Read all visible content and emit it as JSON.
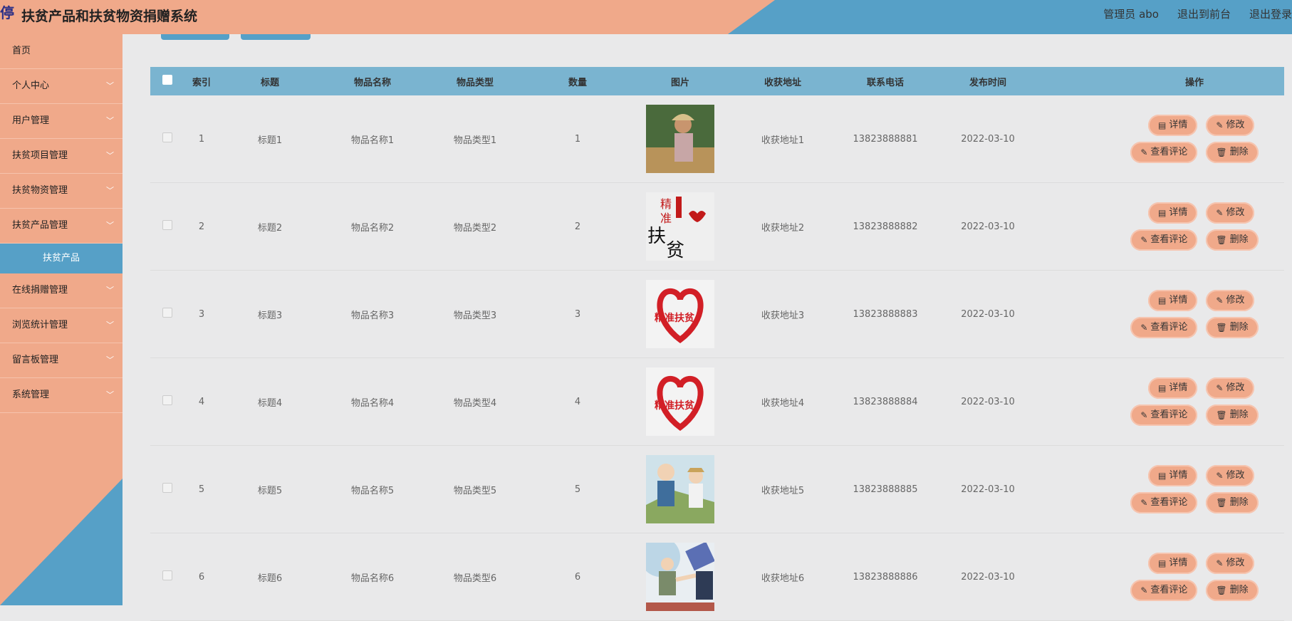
{
  "app": {
    "logo_glyph": "停",
    "title": "扶贫产品和扶贫物资捐赠系统"
  },
  "topbar": {
    "user": "管理员 abo",
    "to_front": "退出到前台",
    "logout": "退出登录"
  },
  "sidebar": {
    "items": [
      {
        "label": "首页",
        "has_chevron": false
      },
      {
        "label": "个人中心",
        "has_chevron": true
      },
      {
        "label": "用户管理",
        "has_chevron": true
      },
      {
        "label": "扶贫项目管理",
        "has_chevron": true
      },
      {
        "label": "扶贫物资管理",
        "has_chevron": true
      },
      {
        "label": "扶贫产品管理",
        "has_chevron": true
      }
    ],
    "active_sub": "扶贫产品",
    "items_after": [
      {
        "label": "在线捐赠管理"
      },
      {
        "label": "浏览统计管理"
      },
      {
        "label": "留言板管理"
      },
      {
        "label": "系统管理"
      }
    ]
  },
  "table": {
    "headers": {
      "index": "索引",
      "title": "标题",
      "name": "物品名称",
      "type": "物品类型",
      "qty": "数量",
      "image": "图片",
      "addr": "收获地址",
      "phone": "联系电话",
      "time": "发布时间",
      "ops": "操作"
    },
    "rows": [
      {
        "index": "1",
        "title": "标题1",
        "name": "物品名称1",
        "type": "物品类型1",
        "qty": "1",
        "image": "photo-farmer",
        "addr": "收获地址1",
        "phone": "13823888881",
        "time": "2022-03-10"
      },
      {
        "index": "2",
        "title": "标题2",
        "name": "物品名称2",
        "type": "物品类型2",
        "qty": "2",
        "image": "jingzhun-fupin-calligraphy",
        "addr": "收获地址2",
        "phone": "13823888882",
        "time": "2022-03-10"
      },
      {
        "index": "3",
        "title": "标题3",
        "name": "物品名称3",
        "type": "物品类型3",
        "qty": "3",
        "image": "heart-logo",
        "addr": "收获地址3",
        "phone": "13823888883",
        "time": "2022-03-10"
      },
      {
        "index": "4",
        "title": "标题4",
        "name": "物品名称4",
        "type": "物品类型4",
        "qty": "4",
        "image": "heart-logo",
        "addr": "收获地址4",
        "phone": "13823888884",
        "time": "2022-03-10"
      },
      {
        "index": "5",
        "title": "标题5",
        "name": "物品名称5",
        "type": "物品类型5",
        "qty": "5",
        "image": "cartoon-farmers",
        "addr": "收获地址5",
        "phone": "13823888885",
        "time": "2022-03-10"
      },
      {
        "index": "6",
        "title": "标题6",
        "name": "物品名称6",
        "type": "物品类型6",
        "qty": "6",
        "image": "cartoon-handshake",
        "addr": "收获地址6",
        "phone": "13823888886",
        "time": "2022-03-10"
      }
    ],
    "actions": {
      "detail": "详情",
      "edit": "修改",
      "comments": "查看评论",
      "delete": "删除"
    }
  },
  "colors": {
    "peach": "#f0a98a",
    "blue": "#56a0c7",
    "header_blue": "#7ab4d0"
  }
}
